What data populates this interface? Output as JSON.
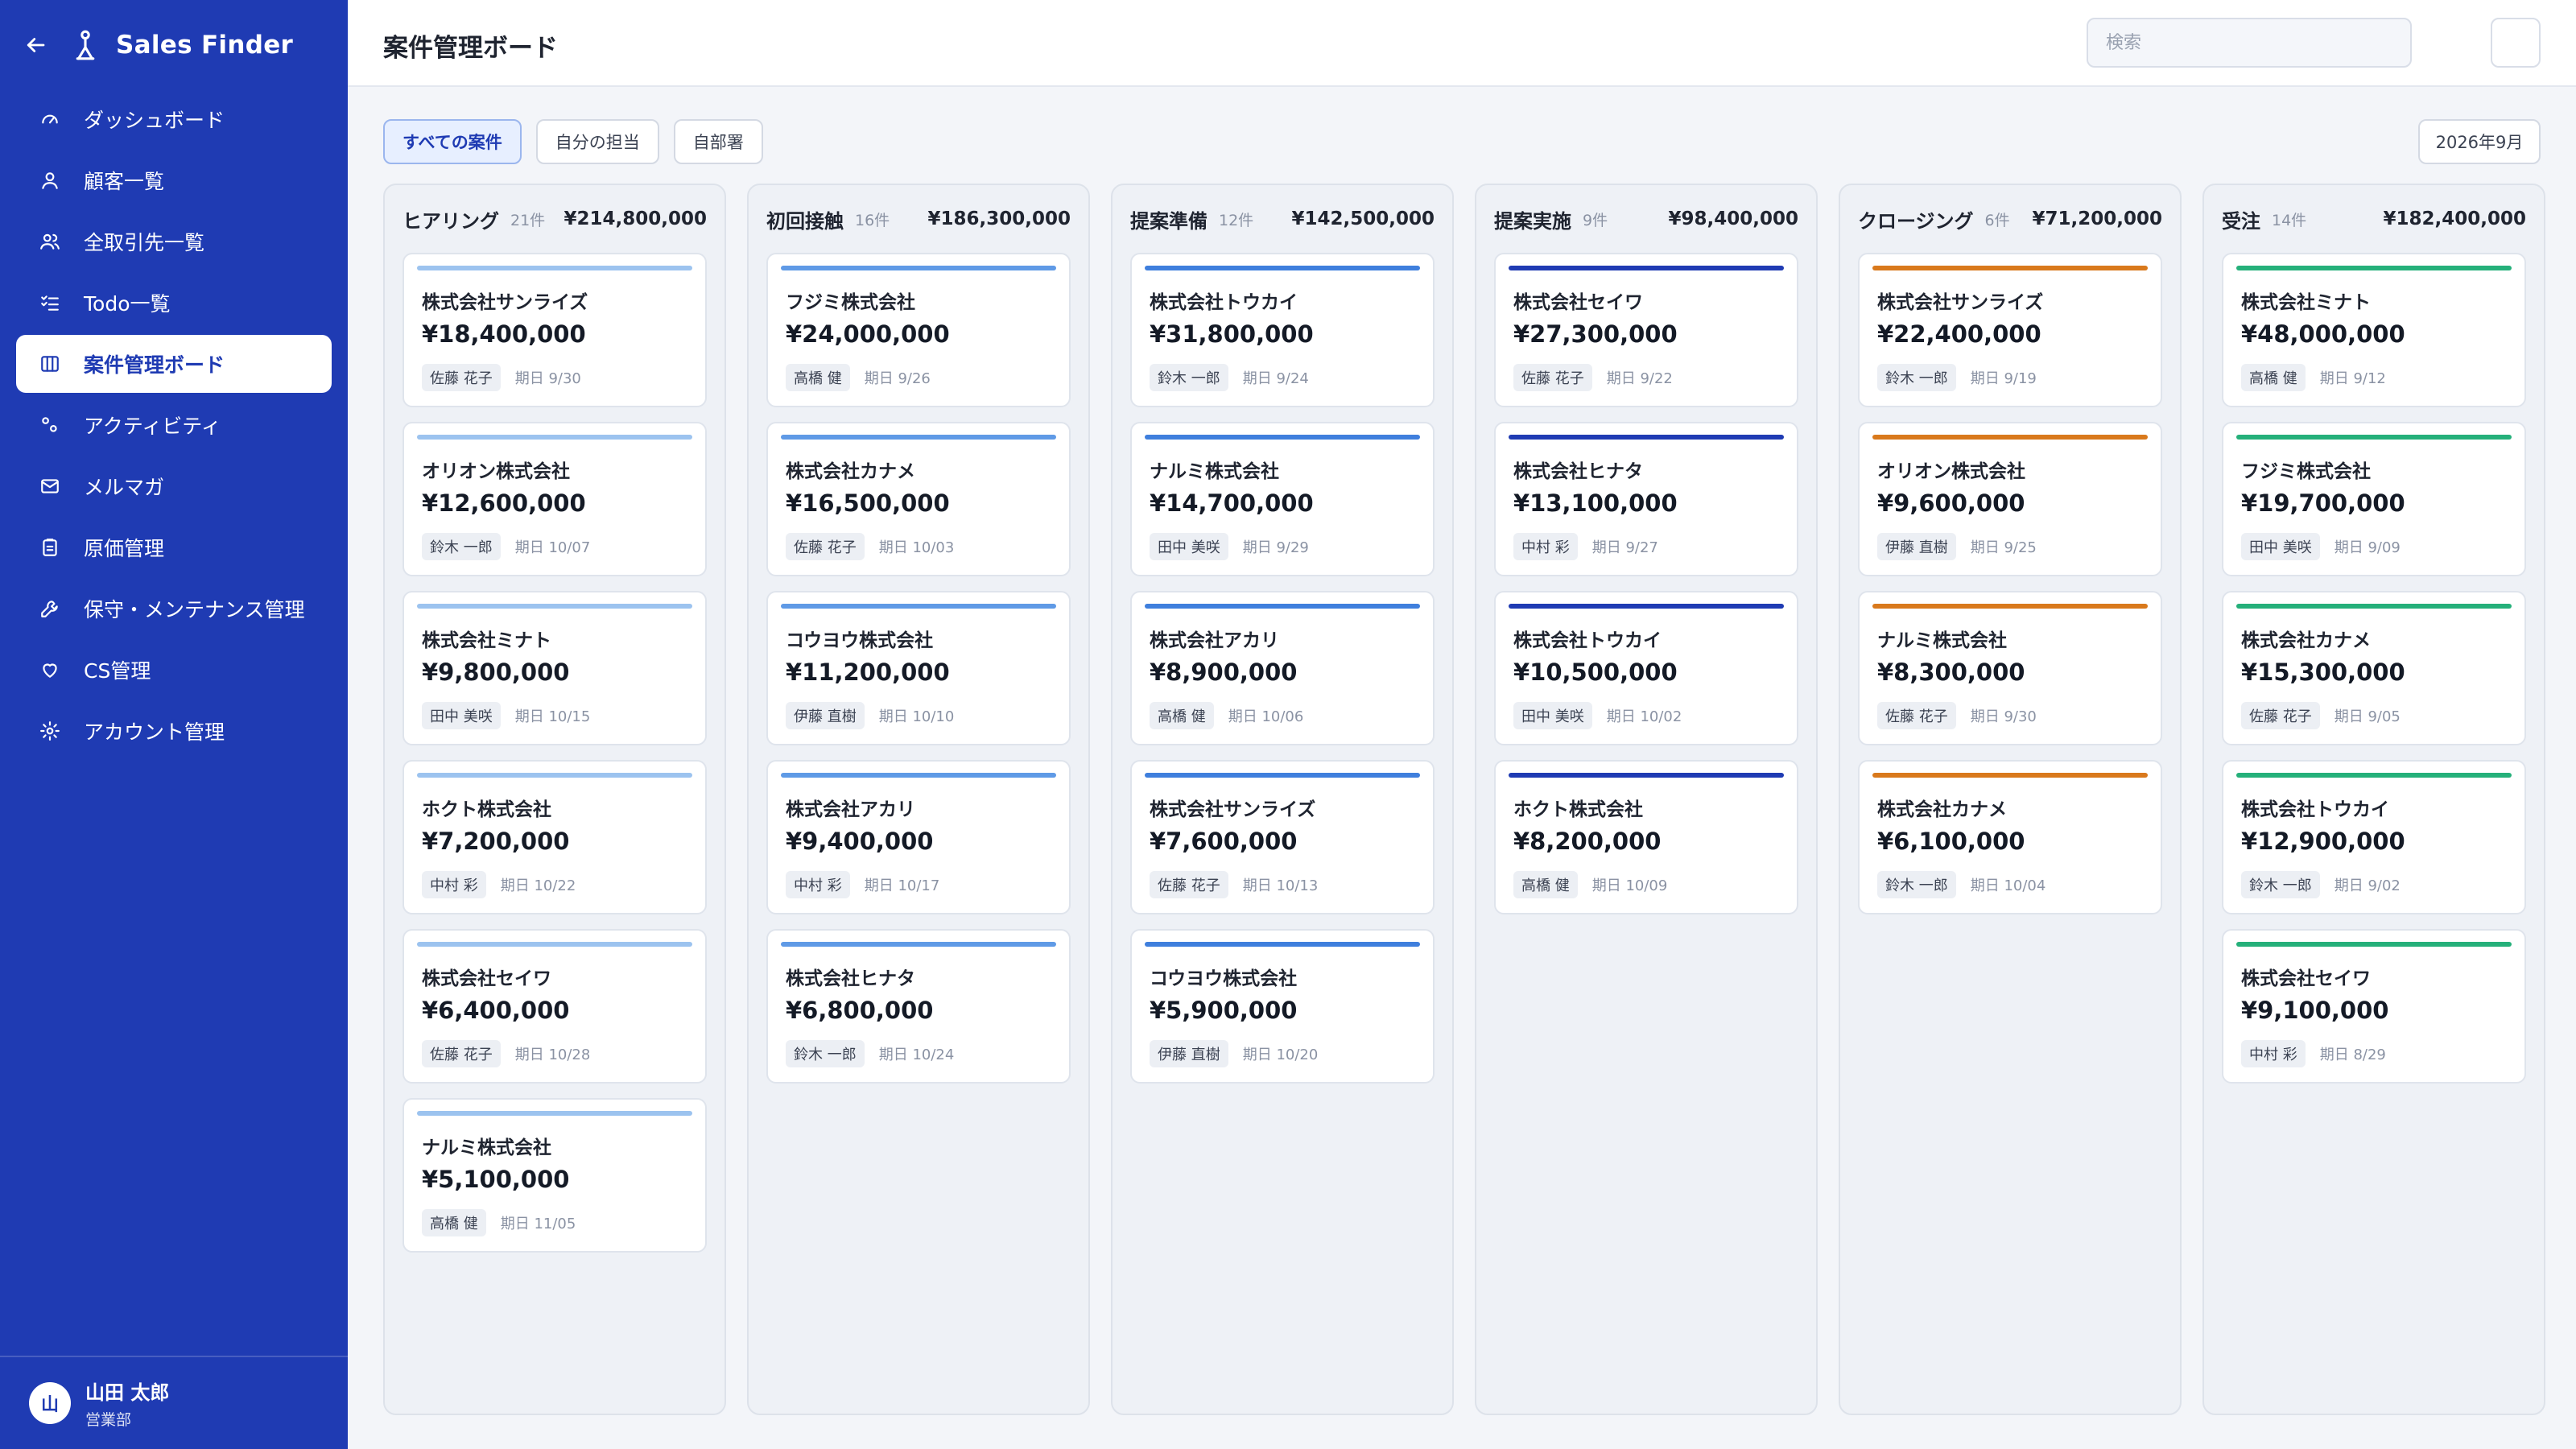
{
  "app": {
    "name": "Sales Finder"
  },
  "nav": [
    {
      "label": "ダッシュボード",
      "icon": "gauge-icon",
      "active": false
    },
    {
      "label": "顧客一覧",
      "icon": "user-icon",
      "active": false
    },
    {
      "label": "全取引先一覧",
      "icon": "users-icon",
      "active": false
    },
    {
      "label": "Todo一覧",
      "icon": "checklist-icon",
      "active": false
    },
    {
      "label": "案件管理ボード",
      "icon": "board-icon",
      "active": true
    },
    {
      "label": "アクティビティ",
      "icon": "activity-icon",
      "active": false
    },
    {
      "label": "メルマガ",
      "icon": "mail-icon",
      "active": false
    },
    {
      "label": "原価管理",
      "icon": "clipboard-icon",
      "active": false
    },
    {
      "label": "保守・メンテナンス管理",
      "icon": "wrench-icon",
      "active": false
    },
    {
      "label": "CS管理",
      "icon": "heart-icon",
      "active": false
    },
    {
      "label": "アカウント管理",
      "icon": "gear-icon",
      "active": false
    }
  ],
  "user": {
    "initial": "山",
    "name": "山田 太郎",
    "dept": "営業部"
  },
  "header": {
    "title": "案件管理ボード",
    "search_placeholder": "検索"
  },
  "filters": [
    {
      "label": "すべての案件",
      "active": true
    },
    {
      "label": "自分の担当",
      "active": false
    },
    {
      "label": "自部署",
      "active": false
    }
  ],
  "month": "2026年9月",
  "columns": [
    {
      "title": "ヒアリング",
      "count": "21件",
      "total": "¥214,800,000",
      "color": "#9cc3ef",
      "cards": [
        {
          "company": "株式会社サンライズ",
          "amount": "¥18,400,000",
          "owner": "佐藤 花子",
          "due": "期日 9/30"
        },
        {
          "company": "オリオン株式会社",
          "amount": "¥12,600,000",
          "owner": "鈴木 一郎",
          "due": "期日 10/07"
        },
        {
          "company": "株式会社ミナト",
          "amount": "¥9,800,000",
          "owner": "田中 美咲",
          "due": "期日 10/15"
        },
        {
          "company": "ホクト株式会社",
          "amount": "¥7,200,000",
          "owner": "中村 彩",
          "due": "期日 10/22"
        },
        {
          "company": "株式会社セイワ",
          "amount": "¥6,400,000",
          "owner": "佐藤 花子",
          "due": "期日 10/28"
        },
        {
          "company": "ナルミ株式会社",
          "amount": "¥5,100,000",
          "owner": "高橋 健",
          "due": "期日 11/05"
        }
      ]
    },
    {
      "title": "初回接触",
      "count": "16件",
      "total": "¥186,300,000",
      "color": "#5f9ae6",
      "cards": [
        {
          "company": "フジミ株式会社",
          "amount": "¥24,000,000",
          "owner": "高橋 健",
          "due": "期日 9/26"
        },
        {
          "company": "株式会社カナメ",
          "amount": "¥16,500,000",
          "owner": "佐藤 花子",
          "due": "期日 10/03"
        },
        {
          "company": "コウヨウ株式会社",
          "amount": "¥11,200,000",
          "owner": "伊藤 直樹",
          "due": "期日 10/10"
        },
        {
          "company": "株式会社アカリ",
          "amount": "¥9,400,000",
          "owner": "中村 彩",
          "due": "期日 10/17"
        },
        {
          "company": "株式会社ヒナタ",
          "amount": "¥6,800,000",
          "owner": "鈴木 一郎",
          "due": "期日 10/24"
        }
      ]
    },
    {
      "title": "提案準備",
      "count": "12件",
      "total": "¥142,500,000",
      "color": "#3f7fdd",
      "cards": [
        {
          "company": "株式会社トウカイ",
          "amount": "¥31,800,000",
          "owner": "鈴木 一郎",
          "due": "期日 9/24"
        },
        {
          "company": "ナルミ株式会社",
          "amount": "¥14,700,000",
          "owner": "田中 美咲",
          "due": "期日 9/29"
        },
        {
          "company": "株式会社アカリ",
          "amount": "¥8,900,000",
          "owner": "高橋 健",
          "due": "期日 10/06"
        },
        {
          "company": "株式会社サンライズ",
          "amount": "¥7,600,000",
          "owner": "佐藤 花子",
          "due": "期日 10/13"
        },
        {
          "company": "コウヨウ株式会社",
          "amount": "¥5,900,000",
          "owner": "伊藤 直樹",
          "due": "期日 10/20"
        }
      ]
    },
    {
      "title": "提案実施",
      "count": "9件",
      "total": "¥98,400,000",
      "color": "#1f3bb3",
      "cards": [
        {
          "company": "株式会社セイワ",
          "amount": "¥27,300,000",
          "owner": "佐藤 花子",
          "due": "期日 9/22"
        },
        {
          "company": "株式会社ヒナタ",
          "amount": "¥13,100,000",
          "owner": "中村 彩",
          "due": "期日 9/27"
        },
        {
          "company": "株式会社トウカイ",
          "amount": "¥10,500,000",
          "owner": "田中 美咲",
          "due": "期日 10/02"
        },
        {
          "company": "ホクト株式会社",
          "amount": "¥8,200,000",
          "owner": "高橋 健",
          "due": "期日 10/09"
        }
      ]
    },
    {
      "title": "クロージング",
      "count": "6件",
      "total": "¥71,200,000",
      "color": "#d9791c",
      "cards": [
        {
          "company": "株式会社サンライズ",
          "amount": "¥22,400,000",
          "owner": "鈴木 一郎",
          "due": "期日 9/19"
        },
        {
          "company": "オリオン株式会社",
          "amount": "¥9,600,000",
          "owner": "伊藤 直樹",
          "due": "期日 9/25"
        },
        {
          "company": "ナルミ株式会社",
          "amount": "¥8,300,000",
          "owner": "佐藤 花子",
          "due": "期日 9/30"
        },
        {
          "company": "株式会社カナメ",
          "amount": "¥6,100,000",
          "owner": "鈴木 一郎",
          "due": "期日 10/04"
        }
      ]
    },
    {
      "title": "受注",
      "count": "14件",
      "total": "¥182,400,000",
      "color": "#25b07a",
      "cards": [
        {
          "company": "株式会社ミナト",
          "amount": "¥48,000,000",
          "owner": "高橋 健",
          "due": "期日 9/12"
        },
        {
          "company": "フジミ株式会社",
          "amount": "¥19,700,000",
          "owner": "田中 美咲",
          "due": "期日 9/09"
        },
        {
          "company": "株式会社カナメ",
          "amount": "¥15,300,000",
          "owner": "佐藤 花子",
          "due": "期日 9/05"
        },
        {
          "company": "株式会社トウカイ",
          "amount": "¥12,900,000",
          "owner": "鈴木 一郎",
          "due": "期日 9/02"
        },
        {
          "company": "株式会社セイワ",
          "amount": "¥9,100,000",
          "owner": "中村 彩",
          "due": "期日 8/29"
        }
      ]
    }
  ]
}
